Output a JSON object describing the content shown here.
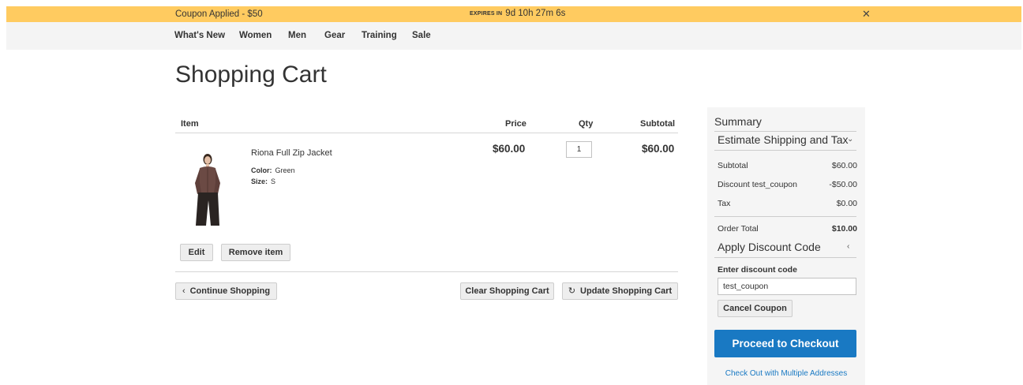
{
  "promo": {
    "coupon_text": "Coupon Applied - $50",
    "expires_label": "EXPIRES IN",
    "countdown": "9d 10h 27m 6s",
    "close_glyph": "✕"
  },
  "nav": {
    "items": [
      "What's New",
      "Women",
      "Men",
      "Gear",
      "Training",
      "Sale"
    ]
  },
  "page_title": "Shopping Cart",
  "cart": {
    "headers": {
      "item": "Item",
      "price": "Price",
      "qty": "Qty",
      "subtotal": "Subtotal"
    },
    "product": {
      "name": "Riona Full Zip Jacket",
      "options": [
        {
          "label": "Color:",
          "value": "Green"
        },
        {
          "label": "Size:",
          "value": "S"
        }
      ],
      "price": "$60.00",
      "qty": "1",
      "subtotal": "$60.00",
      "colors": {
        "jacket": "#6b4a44",
        "pants": "#2a2422",
        "skin": "#e4bfa6",
        "hair": "#3a2a20"
      }
    },
    "buttons": {
      "edit": "Edit",
      "remove": "Remove item",
      "continue": "Continue Shopping",
      "clear": "Clear Shopping Cart",
      "update": "Update Shopping Cart"
    },
    "icons": {
      "continue": "chevron-left-icon",
      "update": "refresh-icon"
    }
  },
  "summary": {
    "title": "Summary",
    "estimate_label": "Estimate Shipping and Tax",
    "rows": [
      {
        "label": "Subtotal",
        "value": "$60.00"
      },
      {
        "label": "Discount test_coupon",
        "value": "-$50.00"
      },
      {
        "label": "Tax",
        "value": "$0.00"
      }
    ],
    "order_total": {
      "label": "Order Total",
      "value": "$10.00"
    },
    "discount_section": "Apply Discount Code",
    "discount_field_label": "Enter discount code",
    "discount_value": "test_coupon",
    "cancel_coupon": "Cancel Coupon",
    "checkout": "Proceed to Checkout",
    "multi_address": "Check Out with Multiple Addresses",
    "colors": {
      "checkout": "#1979c3",
      "panel": "#f5f5f5"
    }
  },
  "colors": {
    "promo_bar": "#ffcb60",
    "nav_bar": "#f4f4f4"
  }
}
